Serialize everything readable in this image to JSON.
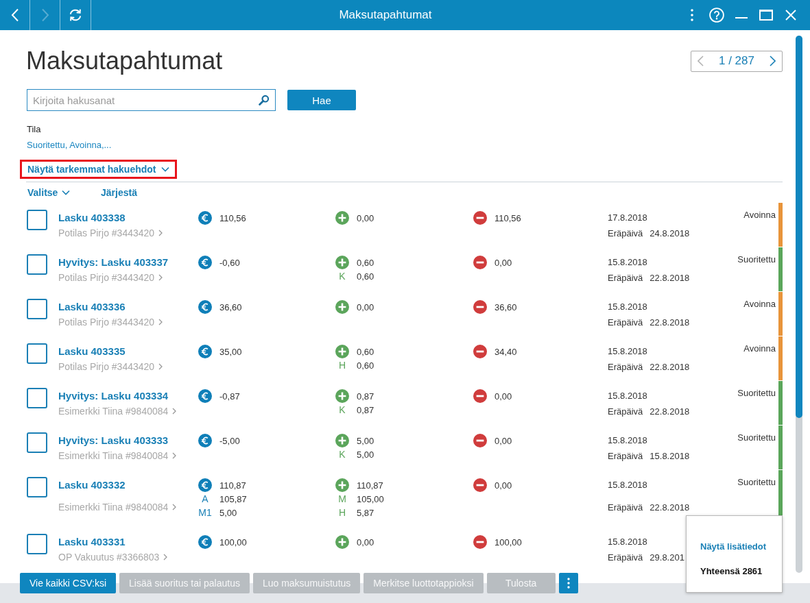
{
  "titlebar": {
    "title": "Maksutapahtumat",
    "nav": [
      {
        "kind": "back",
        "disabled": false
      },
      {
        "kind": "forward",
        "disabled": true
      },
      {
        "kind": "refresh",
        "disabled": false
      }
    ]
  },
  "page": {
    "title": "Maksutapahtumat",
    "pager": {
      "text": "1 / 287",
      "prev_disabled": true,
      "next_disabled": false
    }
  },
  "search": {
    "placeholder": "Kirjoita hakusanat",
    "button": "Hae"
  },
  "filter": {
    "label": "Tila",
    "value": "Suoritettu, Avoinna,..."
  },
  "more_filters": {
    "label": "Näytä tarkemmat hakuehdot",
    "highlighted": true
  },
  "list_toolbar": [
    {
      "label": "Valitse",
      "kind": "dropdown"
    },
    {
      "label": "Järjestä",
      "kind": "link"
    }
  ],
  "rows": [
    {
      "checked": false,
      "title": "Lasku 403338",
      "customer": "Potilas Pirjo #3443420",
      "amount": {
        "value": "110,56"
      },
      "paid": {
        "value": "0,00"
      },
      "remaining": {
        "value": "110,56"
      },
      "date": "17.8.2018",
      "due_label": "Eräpäivä",
      "due_date": "24.8.2018",
      "status": "Avoinna",
      "color": "#e8943a"
    },
    {
      "checked": false,
      "title": "Hyvitys: Lasku 403337",
      "customer": "Potilas Pirjo #3443420",
      "amount": {
        "value": "-0,60"
      },
      "paid": {
        "value": "0,60",
        "parts": [
          {
            "code": "K",
            "value": "0,60"
          }
        ]
      },
      "remaining": {
        "value": "0,00"
      },
      "date": "15.8.2018",
      "due_label": "Eräpäivä",
      "due_date": "22.8.2018",
      "status": "Suoritettu",
      "color": "#5aa65a"
    },
    {
      "checked": false,
      "title": "Lasku 403336",
      "customer": "Potilas Pirjo #3443420",
      "amount": {
        "value": "36,60"
      },
      "paid": {
        "value": "0,00"
      },
      "remaining": {
        "value": "36,60"
      },
      "date": "15.8.2018",
      "due_label": "Eräpäivä",
      "due_date": "22.8.2018",
      "status": "Avoinna",
      "color": "#e8943a"
    },
    {
      "checked": false,
      "title": "Lasku 403335",
      "customer": "Potilas Pirjo #3443420",
      "amount": {
        "value": "35,00"
      },
      "paid": {
        "value": "0,60",
        "parts": [
          {
            "code": "H",
            "value": "0,60"
          }
        ]
      },
      "remaining": {
        "value": "34,40"
      },
      "date": "15.8.2018",
      "due_label": "Eräpäivä",
      "due_date": "22.8.2018",
      "status": "Avoinna",
      "color": "#e8943a"
    },
    {
      "checked": false,
      "title": "Hyvitys: Lasku 403334",
      "customer": "Esimerkki Tiina #9840084",
      "amount": {
        "value": "-0,87"
      },
      "paid": {
        "value": "0,87",
        "parts": [
          {
            "code": "K",
            "value": "0,87"
          }
        ]
      },
      "remaining": {
        "value": "0,00"
      },
      "date": "15.8.2018",
      "due_label": "Eräpäivä",
      "due_date": "22.8.2018",
      "status": "Suoritettu",
      "color": "#5aa65a"
    },
    {
      "checked": false,
      "title": "Hyvitys: Lasku 403333",
      "customer": "Esimerkki Tiina #9840084",
      "amount": {
        "value": "-5,00"
      },
      "paid": {
        "value": "5,00",
        "parts": [
          {
            "code": "K",
            "value": "5,00"
          }
        ]
      },
      "remaining": {
        "value": "0,00"
      },
      "date": "15.8.2018",
      "due_label": "Eräpäivä",
      "due_date": "15.8.2018",
      "status": "Suoritettu",
      "color": "#5aa65a"
    },
    {
      "checked": false,
      "title": "Lasku 403332",
      "customer": "Esimerkki Tiina #9840084",
      "amount": {
        "value": "110,87",
        "parts": [
          {
            "code": "A",
            "value": "105,87"
          },
          {
            "code": "M1",
            "value": "5,00"
          }
        ]
      },
      "paid": {
        "value": "110,87",
        "parts": [
          {
            "code": "M",
            "value": "105,00"
          },
          {
            "code": "H",
            "value": "5,87"
          }
        ]
      },
      "remaining": {
        "value": "0,00"
      },
      "date": "15.8.2018",
      "due_label": "Eräpäivä",
      "due_date": "22.8.2018",
      "status": "Suoritettu",
      "color": "#5aa65a"
    },
    {
      "checked": false,
      "title": "Lasku 403331",
      "customer": "OP Vakuutus #3366803",
      "amount": {
        "value": "100,00"
      },
      "paid": {
        "value": "0,00"
      },
      "remaining": {
        "value": "100,00"
      },
      "date": "15.8.2018",
      "due_label": "Eräpäivä",
      "due_date": "29.8.201"
    }
  ],
  "summary_popup": {
    "link": "Näytä lisätiedot",
    "total": "Yhteensä 2861"
  },
  "actions": [
    {
      "label": "Vie kaikki CSV:ksi",
      "disabled": false
    },
    {
      "label": "Lisää suoritus tai palautus",
      "disabled": true
    },
    {
      "label": "Luo maksumuistutus",
      "disabled": true
    },
    {
      "label": "Merkitse luottotappioksi",
      "disabled": true
    },
    {
      "label": "Tulosta",
      "disabled": true
    }
  ]
}
